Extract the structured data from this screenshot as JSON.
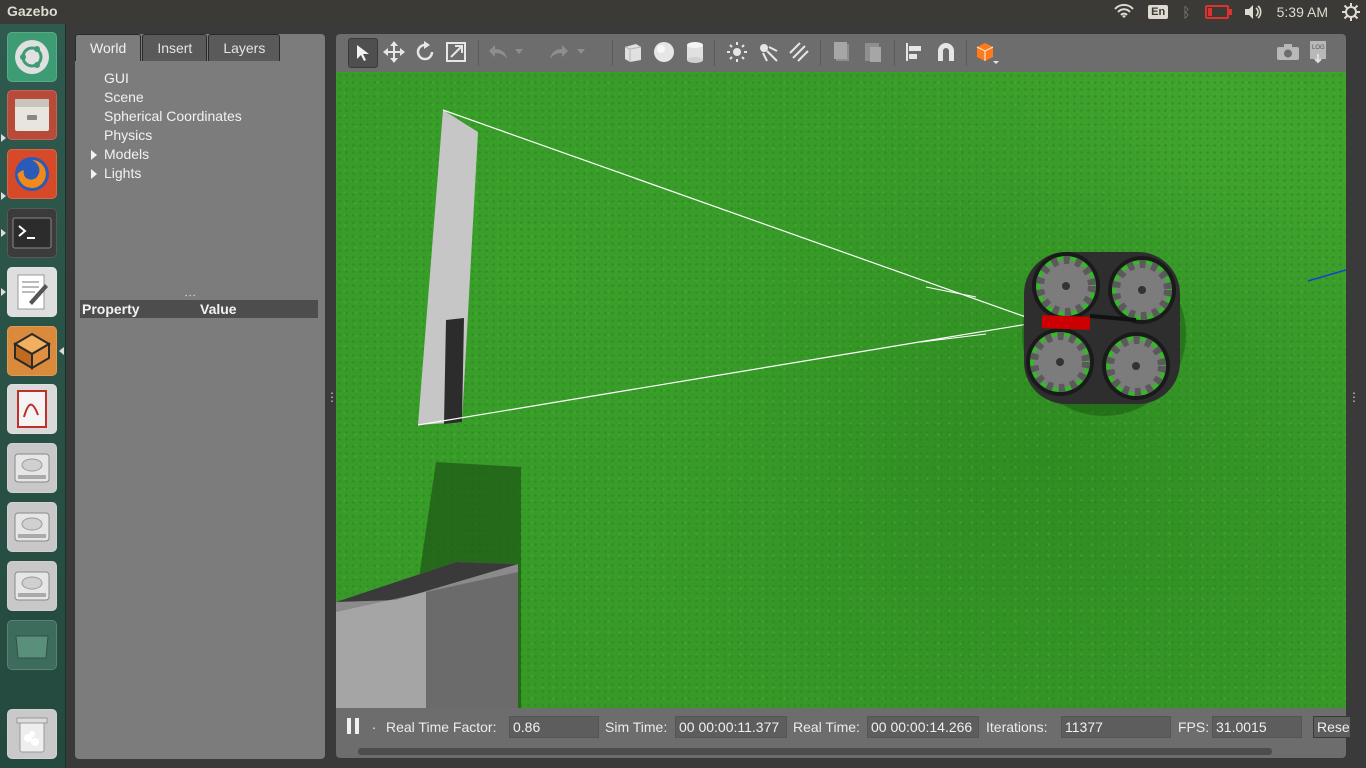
{
  "topbar": {
    "app_title": "Gazebo",
    "keyboard_layout": "En",
    "clock": "5:39 AM",
    "icons": [
      "wifi-icon",
      "keyboard-layout-indicator",
      "bluetooth-icon",
      "battery-icon",
      "volume-icon",
      "system-settings-icon"
    ],
    "battery_color": "#e03030"
  },
  "launcher": {
    "items": [
      "ubuntu-dash",
      "file-manager",
      "firefox",
      "terminal",
      "text-editor",
      "gazebo",
      "document-viewer",
      "disk-drive",
      "disk-drive",
      "disk-drive",
      "workspace-switcher",
      "trash"
    ]
  },
  "left_panel": {
    "tabs": [
      {
        "label": "World",
        "active": true
      },
      {
        "label": "Insert",
        "active": false
      },
      {
        "label": "Layers",
        "active": false
      }
    ],
    "tree": [
      {
        "label": "GUI",
        "expandable": false
      },
      {
        "label": "Scene",
        "expandable": false
      },
      {
        "label": "Spherical Coordinates",
        "expandable": false
      },
      {
        "label": "Physics",
        "expandable": false
      },
      {
        "label": "Models",
        "expandable": true
      },
      {
        "label": "Lights",
        "expandable": true
      }
    ],
    "property_header": {
      "property": "Property",
      "value": "Value"
    }
  },
  "toolbar": {
    "tools": [
      "select-mode",
      "translate-mode",
      "rotate-mode",
      "scale-mode",
      "undo",
      "redo",
      "box-shape",
      "sphere-shape",
      "cylinder-shape",
      "point-light",
      "spot-light",
      "directional-light",
      "copy",
      "paste",
      "align",
      "snap",
      "change-view",
      "screenshot",
      "log"
    ],
    "active_tool": "select-mode"
  },
  "viewport": {
    "scene_colors": {
      "ground": "#379a27",
      "drone_body": "#2b2b2b",
      "drone_rim": "#3bb82c",
      "camera_marker": "#cc0000"
    }
  },
  "status": {
    "real_time_factor_label": "Real Time Factor:",
    "real_time_factor": "0.86",
    "sim_time_label": "Sim Time:",
    "sim_time": "00 00:00:11.377",
    "real_time_label": "Real Time:",
    "real_time": "00 00:00:14.266",
    "iterations_label": "Iterations:",
    "iterations": "11377",
    "fps_label": "FPS:",
    "fps": "31.0015",
    "reset_label": "Reset"
  }
}
